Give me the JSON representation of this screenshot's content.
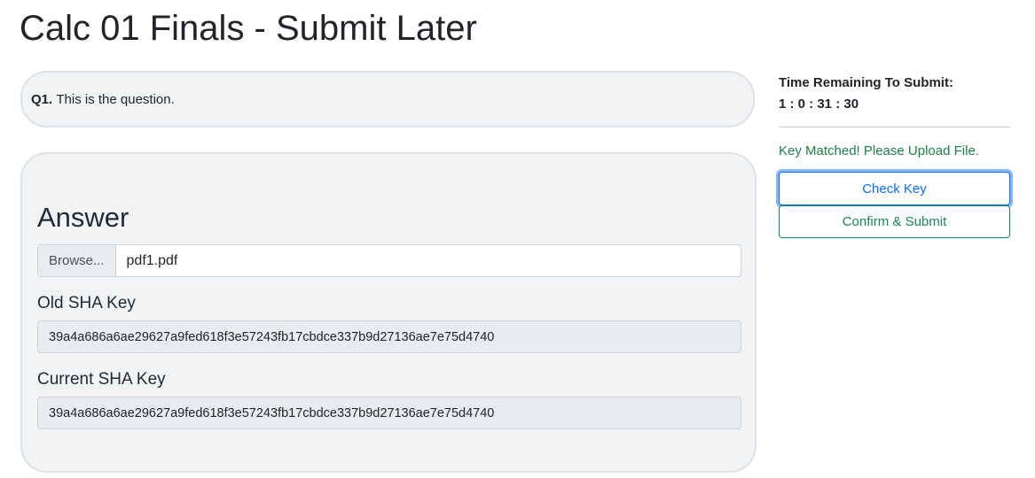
{
  "title": "Calc 01 Finals - Submit Later",
  "question": {
    "number": "Q1.",
    "text": "This is the question."
  },
  "answer": {
    "heading": "Answer",
    "browse_label": "Browse...",
    "file_name": "pdf1.pdf",
    "old_key_label": "Old SHA Key",
    "old_key": "39a4a686a6ae29627a9fed618f3e57243fb17cbdce337b9d27136ae7e75d4740",
    "current_key_label": "Current SHA Key",
    "current_key": "39a4a686a6ae29627a9fed618f3e57243fb17cbdce337b9d27136ae7e75d4740"
  },
  "side": {
    "time_label": "Time Remaining To Submit:",
    "time_value": "1 : 0 : 31 : 30",
    "status": "Key Matched! Please Upload File.",
    "check_label": "Check Key",
    "submit_label": "Confirm & Submit"
  }
}
